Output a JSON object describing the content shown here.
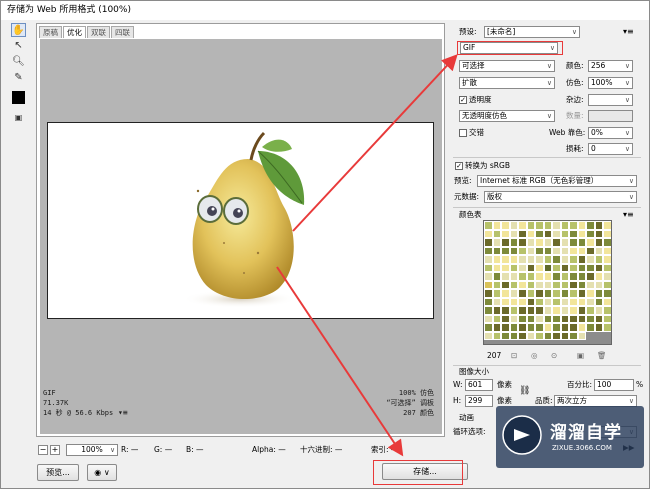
{
  "window": {
    "title": "存储为 Web 所用格式 (100%)"
  },
  "tools": [
    "hand-tool",
    "slice-select-tool",
    "zoom-tool",
    "eyedropper-tool",
    "eyedropper-color",
    "toggle-slices"
  ],
  "tabs": [
    "原稿",
    "优化",
    "双联",
    "四联"
  ],
  "preview_info": {
    "format": "GIF",
    "size": "71.37K",
    "time": "14 秒 @ 56.6 Kbps",
    "dither": "100% 仿色",
    "palette": "“可选择” 调板",
    "colors": "207 颜色"
  },
  "status": {
    "zoom": "100%",
    "r": "R: —",
    "g": "G: —",
    "b": "B: —",
    "alpha": "Alpha: —",
    "hex": "十六进制: —",
    "index": "索引: —"
  },
  "buttons": {
    "preview": "预览...",
    "save": "存储..."
  },
  "panel": {
    "preset_label": "预设:",
    "preset_value": "[未命名]",
    "format": "GIF",
    "reduction": "可选择",
    "colors_label": "颜色:",
    "colors_value": "256",
    "dither_algo": "扩散",
    "dither_label": "仿色:",
    "dither_value": "100%",
    "transparency_label": "透明度",
    "matte_label": "杂边:",
    "trans_dither": "无透明度仿色",
    "amount_label": "数量:",
    "interlaced_label": "交错",
    "websnap_label": "Web 靠色:",
    "websnap_value": "0%",
    "lossy_label": "损耗:",
    "lossy_value": "0",
    "convert_label": "转换为 sRGB",
    "preview_label": "预览:",
    "preview_value": "Internet 标准 RGB（无色彩管理）",
    "metadata_label": "元数据:",
    "metadata_value": "版权",
    "colortable_label": "颜色表",
    "color_count": "207",
    "imagesize_label": "图像大小",
    "w_label": "W:",
    "w_value": "601",
    "px1": "像素",
    "h_label": "H:",
    "h_value": "299",
    "px2": "像素",
    "percent_label": "百分比:",
    "percent_value": "100",
    "percent_unit": "%",
    "quality_label": "品质:",
    "quality_value": "两次立方",
    "animation_label": "动画",
    "loop_label": "循环选项:"
  },
  "watermark": {
    "brand": "溜溜自学",
    "url": "ZIXUE.3066.COM"
  },
  "colors": {
    "annotation_red": "#e83a3a",
    "palette_bg": "#8c8c8c"
  }
}
